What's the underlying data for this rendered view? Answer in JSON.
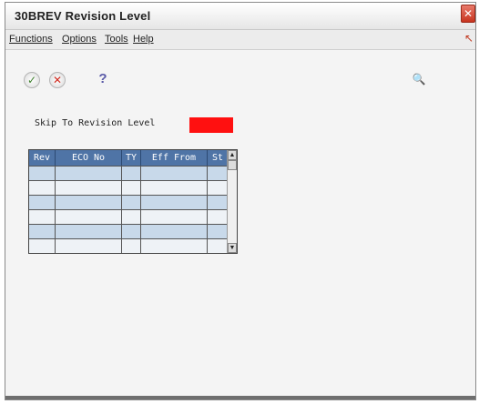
{
  "window": {
    "title": "30BREV   Revision Level",
    "close_glyph": "✕"
  },
  "menu": {
    "items": [
      {
        "label": "Functions"
      },
      {
        "label": "Options"
      },
      {
        "label": "Tools"
      },
      {
        "label": "Help"
      }
    ]
  },
  "toolbar": {
    "ok_icon": "check-icon",
    "ok_glyph": "✓",
    "cancel_icon": "x-icon",
    "cancel_glyph": "✕",
    "help_icon": "question-icon",
    "help_glyph": "?",
    "find_icon": "magnifier-icon",
    "find_glyph": "🔍"
  },
  "form": {
    "skip_label": "Skip To Revision Level",
    "skip_value": "",
    "skip_input_color": "#ff1010"
  },
  "grid": {
    "header_color": "#4f74a6",
    "row_alt_color": "#c8d9ea",
    "columns": [
      "Rev",
      "ECO No",
      "TY",
      "Eff From",
      "St"
    ],
    "rows": [
      [
        "",
        "",
        "",
        "",
        ""
      ],
      [
        "",
        "",
        "",
        "",
        ""
      ],
      [
        "",
        "",
        "",
        "",
        ""
      ],
      [
        "",
        "",
        "",
        "",
        ""
      ],
      [
        "",
        "",
        "",
        "",
        ""
      ],
      [
        "",
        "",
        "",
        "",
        ""
      ]
    ],
    "scroll_up_glyph": "▲",
    "scroll_down_glyph": "▼"
  }
}
